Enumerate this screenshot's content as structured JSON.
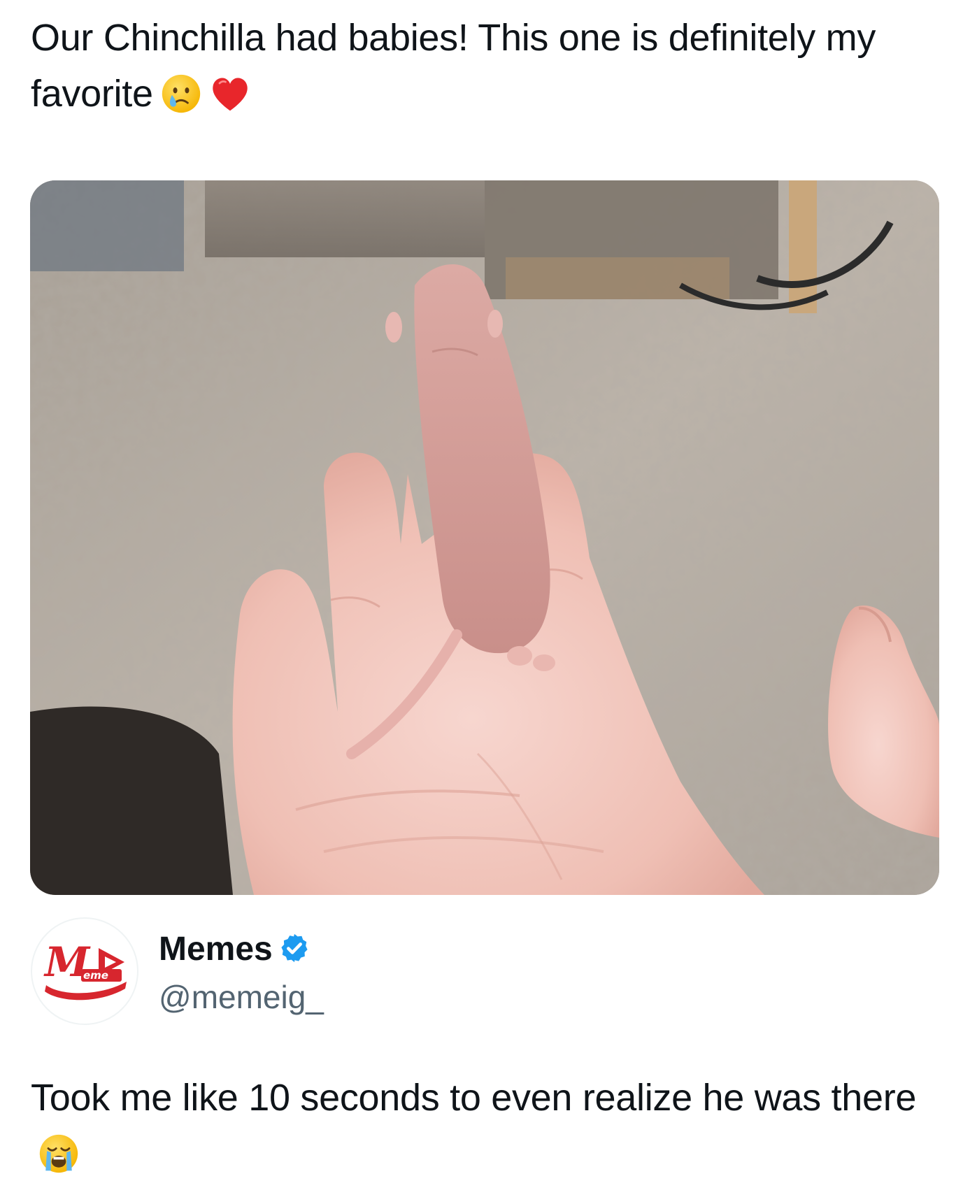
{
  "quoted_post": {
    "text": "Our Chinchilla had babies! This one is definitely my favorite",
    "emojis": [
      "crying-face-emoji",
      "red-heart-emoji"
    ]
  },
  "media": {
    "icon": "photo-newborn-chinchilla-in-palm"
  },
  "author": {
    "name": "Memes",
    "handle": "@memeig_",
    "verified": true,
    "avatar_icon": "meme-logo"
  },
  "reply_post": {
    "text": "Took me like 10 seconds to even realize he was there",
    "emojis": [
      "loudly-crying-face-emoji"
    ]
  },
  "colors": {
    "text": "#0f1419",
    "handle": "#536471",
    "verified_blue": "#1d9bf0",
    "logo_red": "#d7262e"
  }
}
